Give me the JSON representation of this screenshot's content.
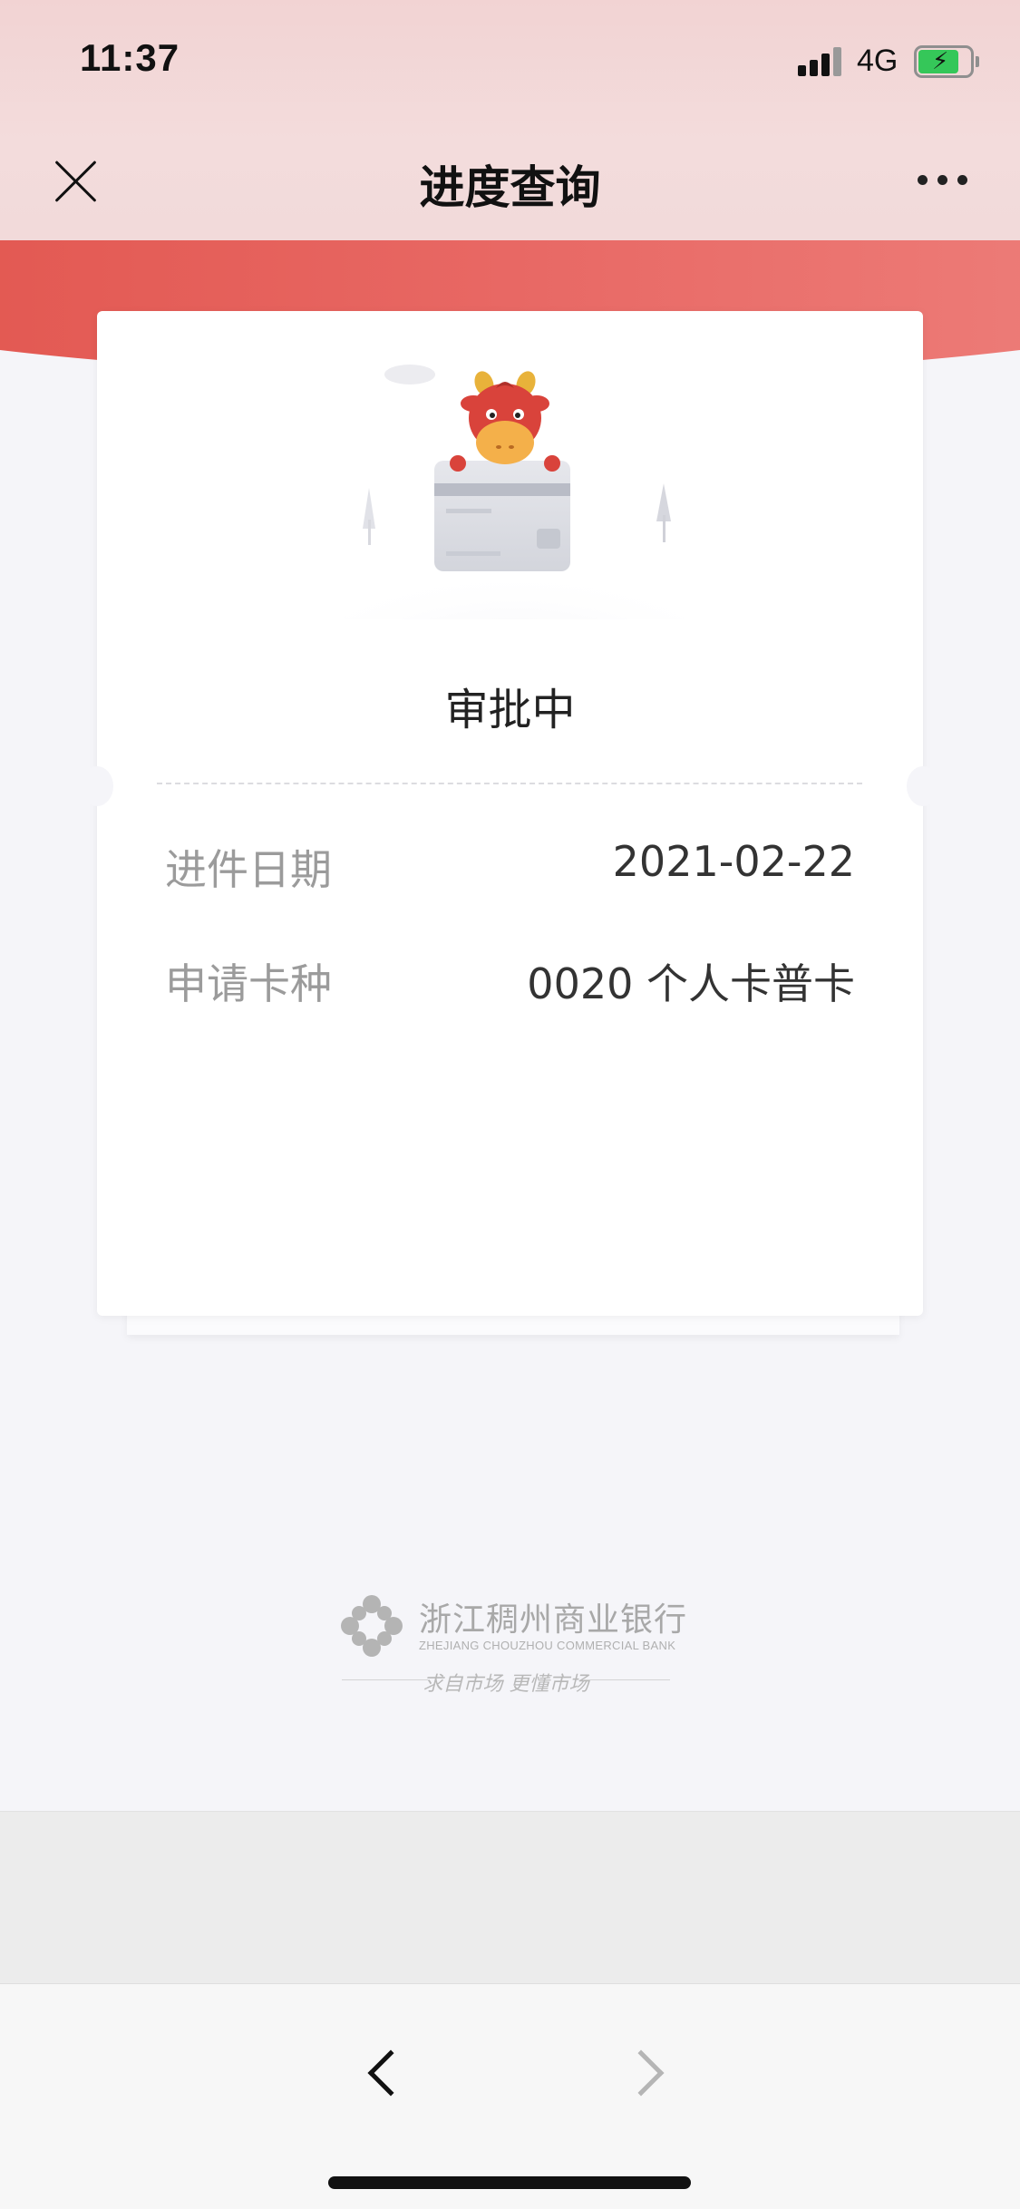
{
  "status_bar": {
    "time": "11:37",
    "network": "4G",
    "icons": [
      "signal-icon",
      "battery-charging-icon"
    ]
  },
  "nav": {
    "title": "进度查询",
    "close_icon": "close-icon",
    "more_icon": "more-icon"
  },
  "card": {
    "illustration": "cow-mascot-card-illustration",
    "status": "审批中",
    "rows": [
      {
        "label": "进件日期",
        "value": "2021-02-22"
      },
      {
        "label": "申请卡种",
        "value": "0020 个人卡普卡"
      }
    ]
  },
  "footer": {
    "bank_name": "浙江稠州商业银行",
    "bank_name_en": "ZHEJIANG CHOUZHOU COMMERCIAL BANK",
    "slogan": "求自市场 更懂市场"
  },
  "browser": {
    "back_icon": "chevron-left-icon",
    "forward_icon": "chevron-right-icon"
  },
  "colors": {
    "accent_red": "#e0524a",
    "header_pink": "#f2d3d3",
    "background": "#f5f5f9"
  }
}
